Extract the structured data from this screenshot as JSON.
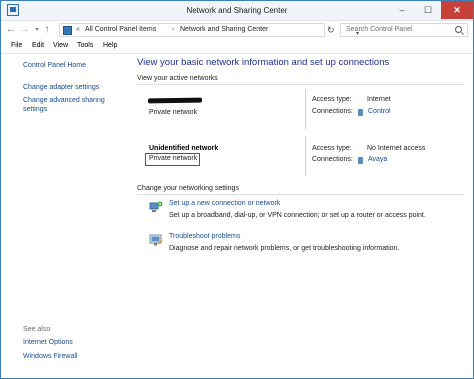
{
  "window": {
    "title": "Network and Sharing Center",
    "controls": {
      "minimize": "–",
      "maximize": "☐",
      "close": "✕"
    }
  },
  "address": {
    "nav": {
      "back": "←",
      "forward": "→",
      "history": "▾",
      "up": "↑"
    },
    "separator1": "«",
    "crumb1": "All Control Panel Items",
    "separator2": "›",
    "crumb2": "Network and Sharing Center",
    "refresh": "↻",
    "search_placeholder": "Search Control Panel"
  },
  "menu": [
    "File",
    "Edit",
    "View",
    "Tools",
    "Help"
  ],
  "sidebar": {
    "items": [
      "Control Panel Home",
      "Change adapter settings",
      "Change advanced sharing",
      "settings"
    ],
    "see_also_label": "See also",
    "see_also": [
      "Internet Options",
      "Windows Firewall"
    ]
  },
  "main": {
    "heading": "View your basic network information and set up connections",
    "active_label": "View your active networks",
    "networks": [
      {
        "name": "",
        "category": "Private network",
        "access_label": "Access type:",
        "access_value": "Internet",
        "connections_label": "Connections:",
        "connection": "Control"
      },
      {
        "name": "Unidentified network",
        "category": "Private network",
        "access_label": "Access type:",
        "access_value": "No Internet access",
        "connections_label": "Connections:",
        "connection": "Avaya"
      }
    ],
    "settings_label": "Change your networking settings",
    "tasks": [
      {
        "link": "Set up a new connection or network",
        "desc": "Set up a broadband, dial-up, or VPN connection; or set up a router or access point.",
        "icon": "new-connection-icon"
      },
      {
        "link": "Troubleshoot problems",
        "desc": "Diagnose and repair network problems, or get troubleshooting information.",
        "icon": "troubleshoot-icon"
      }
    ]
  },
  "colors": {
    "link": "#1a4a8c",
    "heading": "#1e3287",
    "close": "#c7413b",
    "highlight": "#d61f1f"
  }
}
